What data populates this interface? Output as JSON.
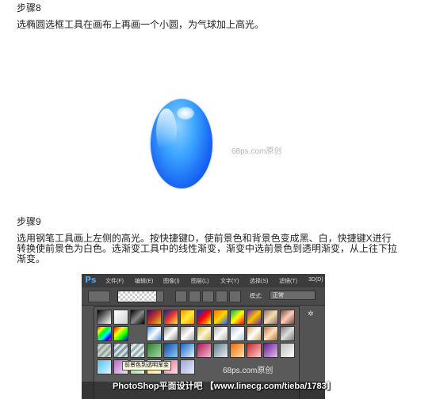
{
  "step8": {
    "title": "步骤8",
    "text": "选椭圆选框工具在画布上再画一个小圆，为气球加上高光。"
  },
  "image1": {
    "watermark": "68ps.com原创"
  },
  "step9": {
    "title": "步骤9",
    "text": "选用钢笔工具画上左侧的高光。按快捷键D，使前景色和背景色变成黑、白，快捷键X进行转换使前景色为白色。选渐变工具中的线性渐变，渐变中选前景色到透明渐变，从上往下拉渐变。"
  },
  "photoshop": {
    "logo": "Ps",
    "menu": [
      "文件(F)",
      "编辑(E)",
      "图像(I)",
      "图层(L)",
      "文字(Y)",
      "选择(S)",
      "滤镜(T)",
      "3D(D)"
    ],
    "mode_label": "模式:",
    "mode_value": "正常",
    "tooltip": "前景色到透明渐变",
    "watermark": "68ps.com原创",
    "footer": "PhotoShop平面设计吧 【www.linecg.com/tieba/1783】"
  }
}
